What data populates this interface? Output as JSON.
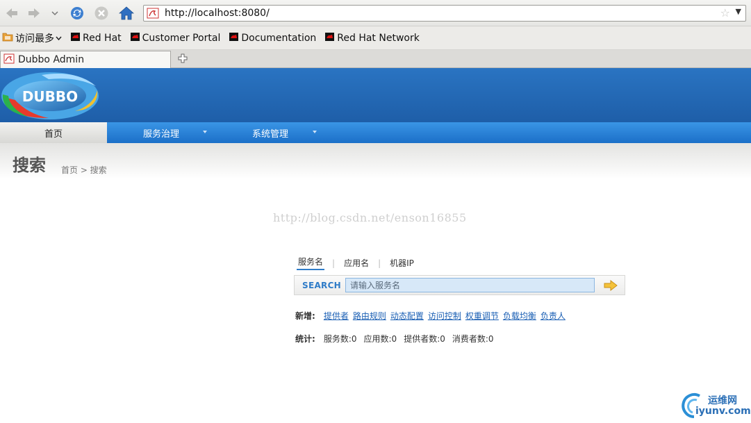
{
  "browser": {
    "url": "http://localhost:8080/",
    "bookmarks": [
      "访问最多",
      "Red Hat",
      "Customer Portal",
      "Documentation",
      "Red Hat Network"
    ],
    "tab_title": "Dubbo Admin"
  },
  "app": {
    "logo_text": "DUBBO",
    "nav": [
      {
        "label": "首页",
        "active": true
      },
      {
        "label": "服务治理",
        "active": false
      },
      {
        "label": "系统管理",
        "active": false
      }
    ],
    "page_title": "搜索",
    "breadcrumb": "首页 > 搜索",
    "watermark": "http://blog.csdn.net/enson16855"
  },
  "search": {
    "tabs": [
      "服务名",
      "应用名",
      "机器IP"
    ],
    "label": "SEARCH",
    "placeholder": "请输入服务名"
  },
  "add": {
    "label": "新增:",
    "links": [
      "提供者",
      "路由规则",
      "动态配置",
      "访问控制",
      "权重调节",
      "负载均衡",
      "负责人"
    ]
  },
  "stats": {
    "label": "统计:",
    "items": [
      "服务数:0",
      "应用数:0",
      "提供者数:0",
      "消费者数:0"
    ]
  },
  "corner_logo": {
    "line1": "运维网",
    "line2": "iyunv.com"
  },
  "colors": {
    "header_blue": "#1e5ea8",
    "nav_blue": "#2a84d8",
    "link": "#1a5fb4"
  }
}
